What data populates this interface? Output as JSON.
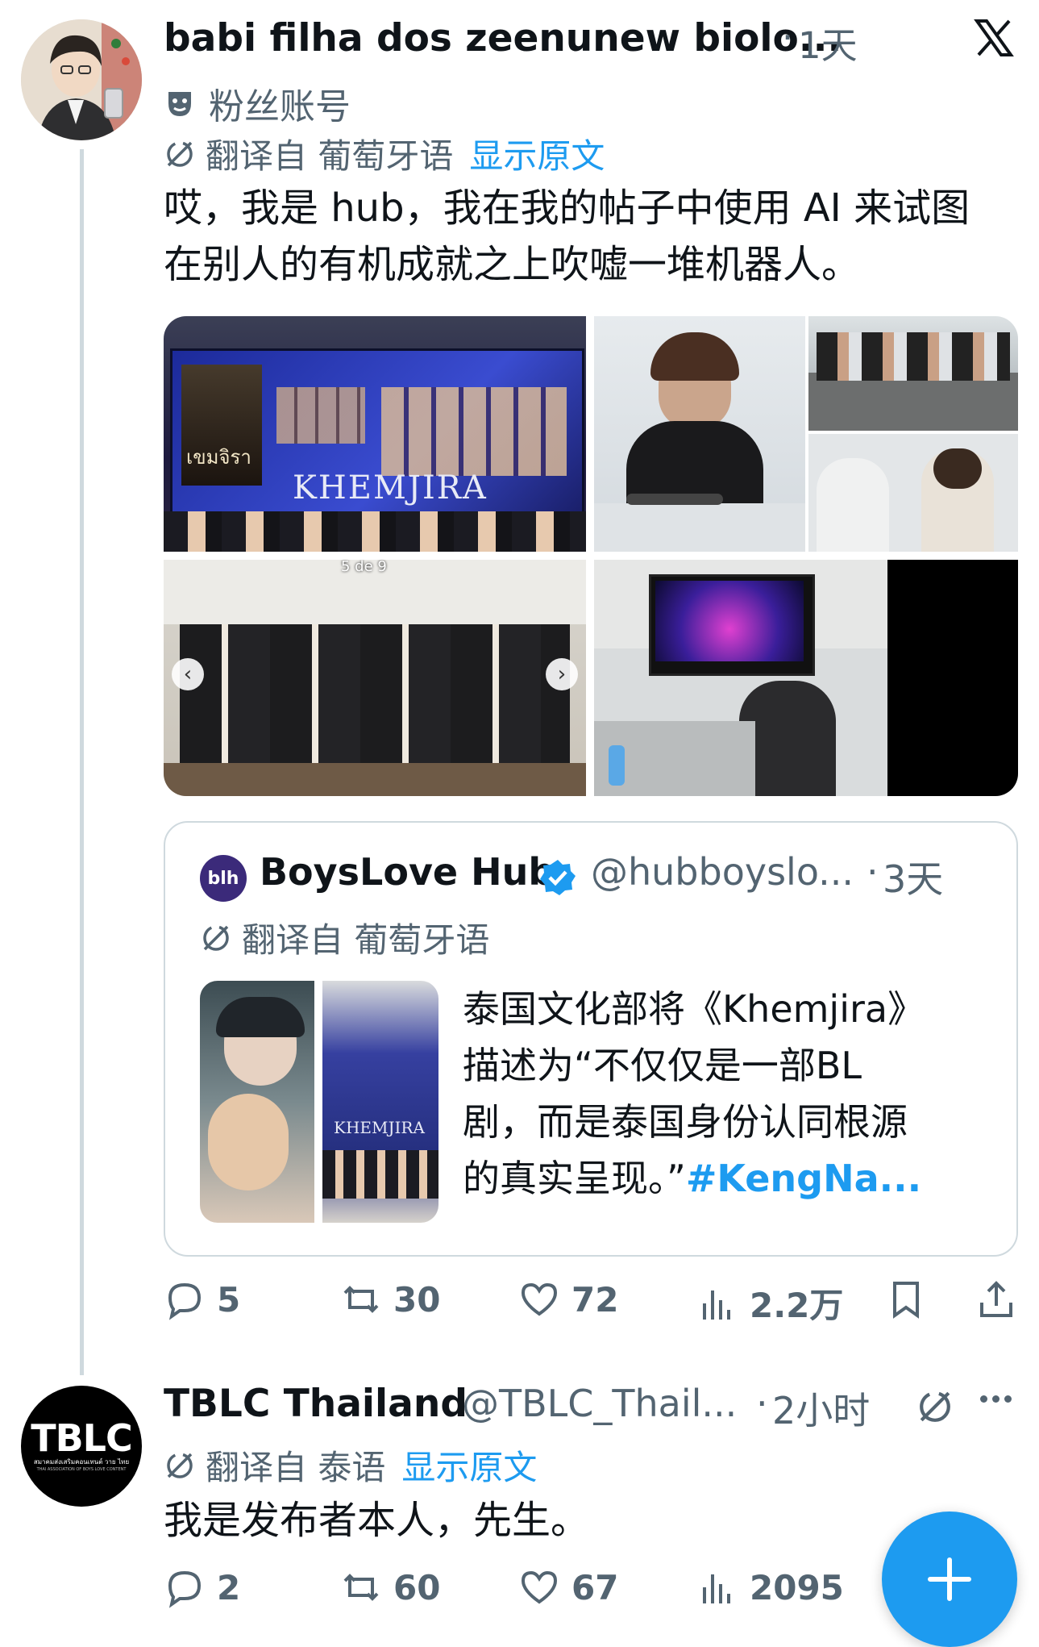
{
  "post1": {
    "author": "babi filha dos zeenunew biolo...",
    "dot": "·",
    "time": "1天",
    "badge": "粉丝账号",
    "translate": {
      "label": "翻译自 葡萄牙语",
      "show": "显示原文"
    },
    "text_line1": "哎，我是 hub，我在我的帖子中使用 AI 来试图",
    "text_line2": "在别人的有机成就之上吹嘘一堆机器人。",
    "images": {
      "tile1": {
        "title": "KHEMJIRA",
        "poster": "เขมจิรา"
      },
      "tile4_counter": "5 de 9"
    },
    "quote": {
      "name": "BoysLove Hub",
      "handle": "@hubboyslo...",
      "dot": "·",
      "time": "3天",
      "translate": "翻译自 葡萄牙语",
      "thumb_title": "KHEMJIRA",
      "line1": "泰国文化部将《Khemjira》",
      "line2": "描述为“不仅仅是一部BL",
      "line3": "剧，而是泰国身份认同根源",
      "line4": "的真实呈现。”",
      "hashtag": "#KengNa..."
    },
    "actions": {
      "replies": "5",
      "reposts": "30",
      "likes": "72",
      "views": "2.2万"
    }
  },
  "post2": {
    "author": "TBLC Thailand",
    "handle": "@TBLC_Thail...",
    "dot": "·",
    "time": "2小时",
    "logo_text": "TBLC",
    "logo_sub": "สมาคมส่งเสริมคอนเทนต์ วาย ไทย",
    "logo_sub2": "THAI ASSOCIATION OF BOYS LOVE CONTENT",
    "translate": {
      "label": "翻译自 泰语",
      "show": "显示原文"
    },
    "text": "我是发布者本人，先生。",
    "actions": {
      "replies": "2",
      "reposts": "60",
      "likes": "67",
      "views": "2095"
    }
  },
  "colors": {
    "accent": "#1d9bf0",
    "muted": "#536471",
    "text": "#0f1419",
    "border": "#cfd9de"
  }
}
